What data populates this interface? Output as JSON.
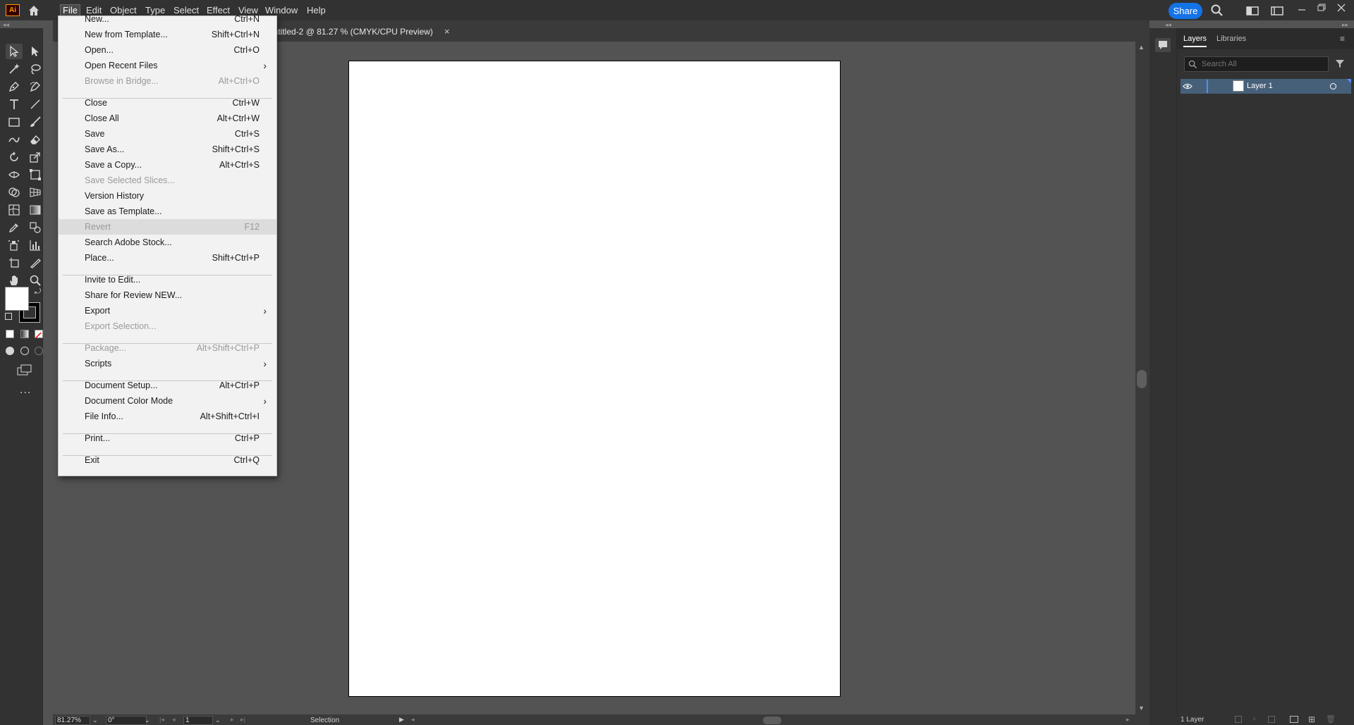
{
  "app": {
    "logo_text": "Ai"
  },
  "menubar": {
    "items": [
      "File",
      "Edit",
      "Object",
      "Type",
      "Select",
      "Effect",
      "View",
      "Window",
      "Help"
    ],
    "share_label": "Share"
  },
  "document_tab": {
    "title": "Untitled-2 @ 81.27 % (CMYK/CPU Preview)",
    "close": "×"
  },
  "file_menu": {
    "items": [
      {
        "label": "New...",
        "shortcut": "Ctrl+N"
      },
      {
        "label": "New from Template...",
        "shortcut": "Shift+Ctrl+N"
      },
      {
        "label": "Open...",
        "shortcut": "Ctrl+O"
      },
      {
        "label": "Open Recent Files",
        "shortcut": "",
        "submenu": true
      },
      {
        "label": "Browse in Bridge...",
        "shortcut": "Alt+Ctrl+O",
        "disabled": true
      },
      {
        "label": "Close",
        "shortcut": "Ctrl+W"
      },
      {
        "label": "Close All",
        "shortcut": "Alt+Ctrl+W"
      },
      {
        "label": "Save",
        "shortcut": "Ctrl+S"
      },
      {
        "label": "Save As...",
        "shortcut": "Shift+Ctrl+S"
      },
      {
        "label": "Save a Copy...",
        "shortcut": "Alt+Ctrl+S"
      },
      {
        "label": "Save Selected Slices...",
        "shortcut": "",
        "disabled": true
      },
      {
        "label": "Version History",
        "shortcut": ""
      },
      {
        "label": "Save as Template...",
        "shortcut": ""
      },
      {
        "label": "Revert",
        "shortcut": "F12",
        "disabled": true,
        "highlighted": true
      },
      {
        "label": "Search Adobe Stock...",
        "shortcut": ""
      },
      {
        "label": "Place...",
        "shortcut": "Shift+Ctrl+P"
      },
      {
        "label": "Invite to Edit...",
        "shortcut": ""
      },
      {
        "label": "Share for Review NEW...",
        "shortcut": ""
      },
      {
        "label": "Export",
        "shortcut": "",
        "submenu": true
      },
      {
        "label": "Export Selection...",
        "shortcut": "",
        "disabled": true
      },
      {
        "label": "Package...",
        "shortcut": "Alt+Shift+Ctrl+P",
        "disabled": true
      },
      {
        "label": "Scripts",
        "shortcut": "",
        "submenu": true
      },
      {
        "label": "Document Setup...",
        "shortcut": "Alt+Ctrl+P"
      },
      {
        "label": "Document Color Mode",
        "shortcut": "",
        "submenu": true
      },
      {
        "label": "File Info...",
        "shortcut": "Alt+Shift+Ctrl+I"
      },
      {
        "label": "Print...",
        "shortcut": "Ctrl+P"
      },
      {
        "label": "Exit",
        "shortcut": "Ctrl+Q"
      }
    ]
  },
  "layers_panel": {
    "tabs": [
      "Layers",
      "Libraries"
    ],
    "search_placeholder": "Search All",
    "layers": [
      {
        "name": "Layer 1"
      }
    ],
    "footer_count": "1 Layer"
  },
  "statusbar": {
    "zoom": "81.27%",
    "rotation": "0°",
    "artboard": "1",
    "tool": "Selection"
  },
  "toolbar": {
    "more": "..."
  }
}
